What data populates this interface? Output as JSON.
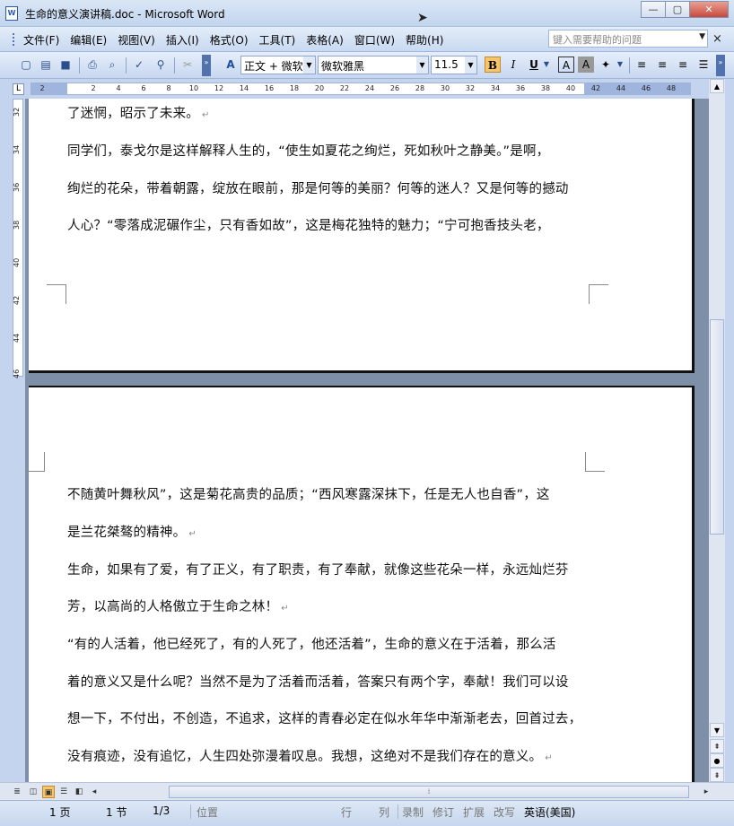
{
  "window": {
    "title": "生命的意义演讲稿.doc - Microsoft Word",
    "app_icon": "W",
    "minimize": "—",
    "maximize": "▢",
    "close": "✕"
  },
  "menu": {
    "items": [
      "文件(F)",
      "编辑(E)",
      "视图(V)",
      "插入(I)",
      "格式(O)",
      "工具(T)",
      "表格(A)",
      "窗口(W)",
      "帮助(H)"
    ],
    "help_placeholder": "键入需要帮助的问题",
    "doc_close": "×"
  },
  "toolbar": {
    "style": "正文 + 微软",
    "font": "微软雅黑",
    "size": "11.5",
    "bold": "B",
    "italic": "I",
    "underline": "U",
    "char_border": "A",
    "char_shading": "A"
  },
  "ruler": {
    "corner": "L",
    "ticks": [
      "2",
      "2",
      "4",
      "6",
      "8",
      "10",
      "12",
      "14",
      "16",
      "18",
      "20",
      "22",
      "24",
      "26",
      "28",
      "30",
      "32",
      "34",
      "36",
      "38",
      "40",
      "42",
      "44",
      "46",
      "48"
    ],
    "vticks": [
      "32",
      "34",
      "36",
      "38",
      "40",
      "42",
      "44",
      "46"
    ]
  },
  "page1": {
    "lines": [
      "了迷惘，昭示了未来。",
      "同学们，泰戈尔是这样解释人生的，“使生如夏花之绚烂，死如秋叶之静美。”是啊，",
      "绚烂的花朵，带着朝露，绽放在眼前，那是何等的美丽？何等的迷人？又是何等的撼动",
      "人心？“零落成泥碾作尘，只有香如故”，这是梅花独特的魅力；“宁可抱香技头老，"
    ]
  },
  "page2": {
    "lines": [
      "不随黄叶舞秋风”，这是菊花高贵的品质；“西风寒露深抹下，任是无人也自香”，这",
      "是兰花桀骜的精神。",
      "生命，如果有了爱，有了正义，有了职责，有了奉献，就像这些花朵一样，永远灿烂芬",
      "芳，以高尚的人格傲立于生命之林！",
      "“有的人活着，他已经死了，有的人死了，他还活着”，生命的意义在于活着，那么活",
      "着的意义又是什么呢？当然不是为了活着而活着，答案只有两个字，奉献！我们可以设",
      "想一下，不付出，不创造，不追求，这样的青春必定在似水年华中渐渐老去，回首过去，",
      "没有痕迹，没有追忆，人生四处弥漫着叹息。我想，这绝对不是我们存在的意义。"
    ],
    "para_mark": "↵"
  },
  "status": {
    "page": "1 页",
    "section": "1 节",
    "page_of": "1/3",
    "position": "位置",
    "line": "行",
    "column": "列",
    "record": "录制",
    "revise": "修订",
    "extend": "扩展",
    "overtype": "改写",
    "language": "英语(美国)"
  }
}
